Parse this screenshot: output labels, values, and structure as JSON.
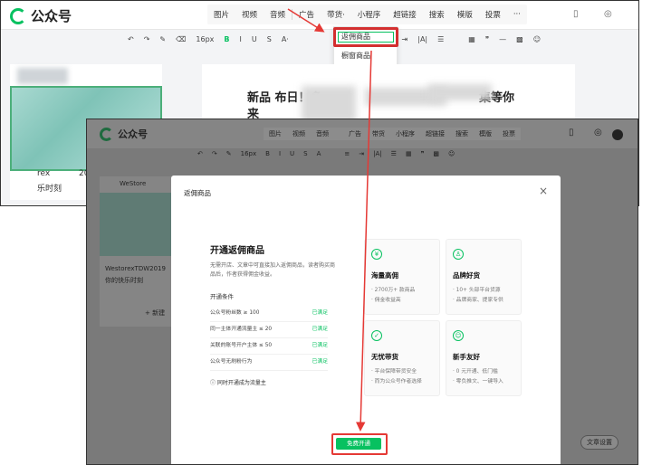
{
  "back": {
    "logo_text": "公众号",
    "menu": [
      "图片",
      "视频",
      "音频",
      "广告",
      "带货·",
      "小程序",
      "超链接",
      "搜索",
      "模版",
      "投票",
      "···"
    ],
    "font_size": "16px",
    "dropdown": [
      "返佣商品",
      "橱窗商品"
    ],
    "article_line1": "rex",
    "article_line2": "乐时刻",
    "article_date": "2019",
    "editor_title_1": "新品   布日！多",
    "editor_title_1_tail": "集等你",
    "editor_title_2": "来"
  },
  "front": {
    "logo_text": "公众号",
    "menu": [
      "图片",
      "视频",
      "音频",
      "广告",
      "带货",
      "小程序",
      "超链接",
      "搜索",
      "模版",
      "投票"
    ],
    "font_size": "16px",
    "card_brand": "WeStore",
    "card_title_1": "WestorexTDW2019",
    "card_title_2": "你的快乐时刻",
    "card_add": "+ 新建",
    "side_button": "文章设置"
  },
  "modal": {
    "title": "返佣商品",
    "close": "×",
    "heading": "开通返佣商品",
    "desc": "无需开店、文章中可直接加入返佣商品，读者购买商品后，作者获得佣金收益。",
    "conditions_title": "开通条件",
    "conditions": [
      {
        "label": "公众号粉丝数 ≥ 100",
        "status": "已满足"
      },
      {
        "label": "同一主体开通流量主 ≤ 20",
        "status": "已满足"
      },
      {
        "label": "关联的账号开户主体 ≤ 50",
        "status": "已满足"
      },
      {
        "label": "公众号无刷粉行为",
        "status": "已满足"
      }
    ],
    "notice": "ⓘ 同时开通成为流量主",
    "features": [
      {
        "icon": "¥",
        "title": "海量高佣",
        "lines": [
          "· 2700万+ 款商品",
          "· 佣金收益高"
        ]
      },
      {
        "icon": "♙",
        "title": "品牌好货",
        "lines": [
          "· 10+ 头部平台货源",
          "· 品牌商家、提家专供"
        ]
      },
      {
        "icon": "✓",
        "title": "无忧带货",
        "lines": [
          "· 平台保障带货安全",
          "· 而为公众号作者选择"
        ]
      },
      {
        "icon": "☺",
        "title": "新手友好",
        "lines": [
          "· 0 元开通、低门槛",
          "· 零负推文、一键导入"
        ]
      }
    ],
    "cta": "免费开通"
  },
  "colors": {
    "accent": "#07c160",
    "annotation": "#e53935"
  }
}
